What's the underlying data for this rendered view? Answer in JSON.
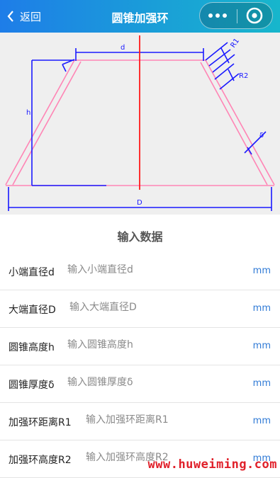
{
  "navbar": {
    "back_label": "返回",
    "title": "圆锥加强环"
  },
  "diagram": {
    "labels": {
      "d": "d",
      "R1": "R1",
      "R2": "R2",
      "h": "h",
      "delta": "δ",
      "D": "D"
    },
    "colors": {
      "dimension": "#1a1aff",
      "cone": "#ff85b5",
      "axis": "#ff1a1a"
    }
  },
  "form": {
    "title": "输入数据",
    "rows": [
      {
        "label": "小端直径d",
        "placeholder": "输入小端直径d",
        "unit": "mm"
      },
      {
        "label": "大端直径D",
        "placeholder": "输入大端直径D",
        "unit": "mm"
      },
      {
        "label": "圆锥高度h",
        "placeholder": "输入圆锥高度h",
        "unit": "mm"
      },
      {
        "label": "圆锥厚度δ",
        "placeholder": "输入圆锥厚度δ",
        "unit": "mm"
      },
      {
        "label": "加强环距离R1",
        "placeholder": "输入加强环距离R1",
        "unit": "mm"
      },
      {
        "label": "加强环高度R2",
        "placeholder": "输入加强环高度R2",
        "unit": "mm"
      }
    ]
  },
  "watermark": "www.huweiming.com"
}
